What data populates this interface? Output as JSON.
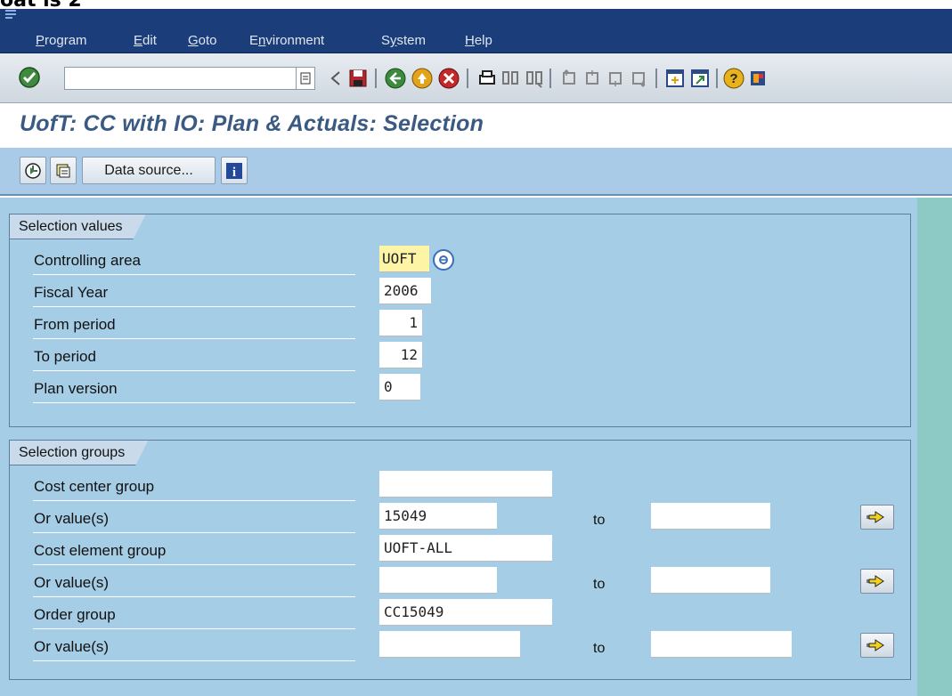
{
  "caption": "oat is 2",
  "menu": {
    "items": [
      {
        "label": "Program",
        "underline": "P",
        "rest": "rogram"
      },
      {
        "label": "Edit",
        "underline": "E",
        "rest": "dit"
      },
      {
        "label": "Goto",
        "underline": "G",
        "rest": "oto"
      },
      {
        "label": "Environment",
        "underline": "n",
        "pre": "E",
        "rest": "vironment"
      },
      {
        "label": "System",
        "underline": "y",
        "pre": "S",
        "rest": "stem"
      },
      {
        "label": "Help",
        "underline": "H",
        "rest": "elp"
      }
    ]
  },
  "toolbar": {
    "command_value": "",
    "icons": [
      "enter-icon",
      "command-dropdown-icon",
      "back-icon",
      "save-icon",
      "back-green-icon",
      "exit-icon",
      "cancel-icon",
      "print-icon",
      "find-icon",
      "find-next-icon",
      "first-page-icon",
      "previous-page-icon",
      "next-page-icon",
      "last-page-icon",
      "create-session-icon",
      "shortcut-icon",
      "help-icon",
      "layout-icon"
    ]
  },
  "title": "UofT: CC with IO: Plan & Actuals: Selection",
  "app_toolbar": {
    "data_source_label": "Data source...",
    "icons": [
      "execute-icon",
      "get-variant-icon",
      "info-icon"
    ]
  },
  "selection_values": {
    "title": "Selection values",
    "rows": [
      {
        "label": "Controlling area",
        "value": "UOFT"
      },
      {
        "label": "Fiscal Year",
        "value": "2006"
      },
      {
        "label": "From period",
        "value": "1"
      },
      {
        "label": "To period",
        "value": "12"
      },
      {
        "label": "Plan version",
        "value": "0"
      }
    ]
  },
  "selection_groups": {
    "title": "Selection groups",
    "rows": [
      {
        "label": "Cost center group",
        "value": ""
      },
      {
        "label": "Or value(s)",
        "value": "15049",
        "to_label": "to",
        "to_value": ""
      },
      {
        "label": "Cost element group",
        "value": "UOFT-ALL"
      },
      {
        "label": "Or value(s)",
        "value": "",
        "to_label": "to",
        "to_value": ""
      },
      {
        "label": "Order group",
        "value": "CC15049"
      },
      {
        "label": "Or value(s)",
        "value": "",
        "to_label": "to",
        "to_value": ""
      }
    ]
  },
  "colors": {
    "menubar": "#1b3d79",
    "title": "#3a5a83",
    "panel": "#a6cde6",
    "required_field": "#fef4a6"
  }
}
